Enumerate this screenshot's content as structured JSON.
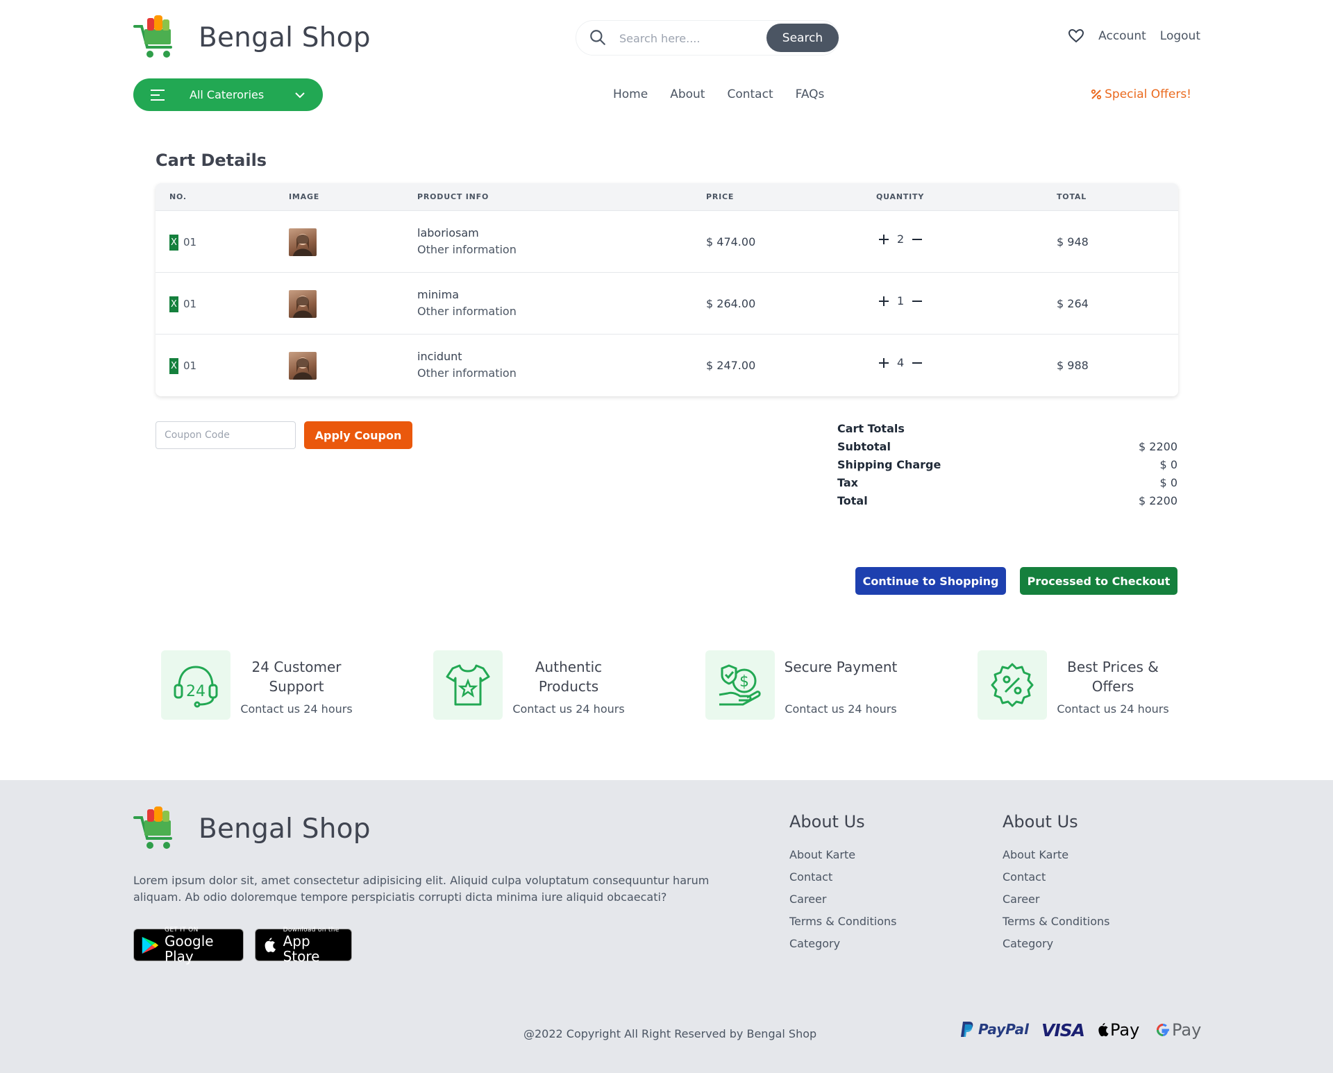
{
  "header": {
    "brand": "Bengal Shop",
    "search": {
      "placeholder": "Search here....",
      "button": "Search"
    },
    "account": "Account",
    "logout": "Logout",
    "categories_button": "All Caterories",
    "nav": [
      "Home",
      "About",
      "Contact",
      "FAQs"
    ],
    "special_offers": "Special Offers!"
  },
  "cart": {
    "title": "Cart Details",
    "columns": [
      "NO.",
      "IMAGE",
      "PRODUCT INFO",
      "PRICE",
      "QUANTITY",
      "TOTAL"
    ],
    "rows": [
      {
        "remove": "X",
        "no": "01",
        "name": "laboriosam",
        "info": "Other information",
        "price": "$ 474.00",
        "qty": "2",
        "total": "$ 948"
      },
      {
        "remove": "X",
        "no": "01",
        "name": "minima",
        "info": "Other information",
        "price": "$ 264.00",
        "qty": "1",
        "total": "$ 264"
      },
      {
        "remove": "X",
        "no": "01",
        "name": "incidunt",
        "info": "Other information",
        "price": "$ 247.00",
        "qty": "4",
        "total": "$ 988"
      }
    ],
    "coupon_placeholder": "Coupon Code",
    "apply_coupon": "Apply Coupon",
    "totals": {
      "heading": "Cart Totals",
      "subtotal_label": "Subtotal",
      "subtotal": "$ 2200",
      "shipping_label": "Shipping Charge",
      "shipping": "$ 0",
      "tax_label": "Tax",
      "tax": "$ 0",
      "total_label": "Total",
      "total": "$ 2200"
    },
    "continue_button": "Continue to Shopping",
    "checkout_button": "Processed to Checkout"
  },
  "features": [
    {
      "icon": "headset-24-icon",
      "title": "24 Customer Support",
      "subtitle": "Contact us 24 hours"
    },
    {
      "icon": "tshirt-star-icon",
      "title": "Authentic Products",
      "subtitle": "Contact us 24 hours"
    },
    {
      "icon": "secure-payment-hand-icon",
      "title": "Secure Payment",
      "subtitle": "Contact us 24 hours"
    },
    {
      "icon": "percent-badge-icon",
      "title": "Best Prices & Offers",
      "subtitle": "Contact us 24 hours"
    }
  ],
  "footer": {
    "brand": "Bengal Shop",
    "description": "Lorem ipsum dolor sit, amet consectetur adipisicing elit. Aliquid culpa voluptatum consequuntur harum aliquam. Ab odio doloremque tempore perspiciatis corrupti dicta minima iure aliquid obcaecati?",
    "google_play": {
      "small": "GET IT ON",
      "big": "Google Play"
    },
    "app_store": {
      "small": "Download on the",
      "big": "App Store"
    },
    "columns": [
      {
        "title": "About Us",
        "links": [
          "About Karte",
          "Contact",
          "Career",
          "Terms & Conditions",
          "Category"
        ]
      },
      {
        "title": "About Us",
        "links": [
          "About Karte",
          "Contact",
          "Career",
          "Terms & Conditions",
          "Category"
        ]
      }
    ],
    "copyright": "@2022 Copyright All Right Reserved by Bengal Shop",
    "payments": {
      "paypal": "PayPal",
      "visa": "VISA",
      "apple_pay": "Pay",
      "google_pay": "Pay"
    }
  },
  "colors": {
    "green": "#22a853",
    "dark_green": "#15803d",
    "orange": "#ea580c",
    "blue": "#1e40af",
    "footer_bg": "#e5e7eb"
  }
}
